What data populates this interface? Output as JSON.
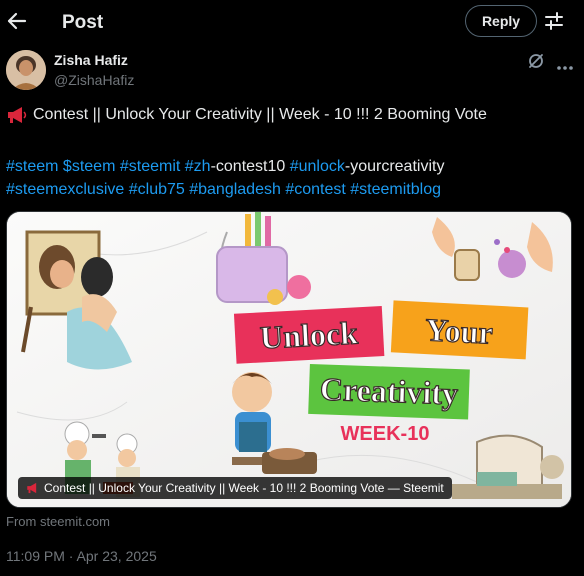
{
  "header": {
    "title": "Post",
    "reply_label": "Reply"
  },
  "author": {
    "name": "Zisha Hafiz",
    "handle": "@ZishaHafiz"
  },
  "post": {
    "title": "Contest || Unlock Your Creativity || Week - 10 !!! 2 Booming Vote",
    "tags_line1": [
      {
        "text": "#steem",
        "type": "tag"
      },
      {
        "text": " ",
        "type": "plain"
      },
      {
        "text": "$steem",
        "type": "tag"
      },
      {
        "text": " ",
        "type": "plain"
      },
      {
        "text": "#steemit",
        "type": "tag"
      },
      {
        "text": " ",
        "type": "plain"
      },
      {
        "text": "#zh",
        "type": "tag"
      },
      {
        "text": "-contest10 ",
        "type": "plain"
      },
      {
        "text": "#unlock",
        "type": "tag"
      },
      {
        "text": "-yourcreativity",
        "type": "plain"
      }
    ],
    "tags_line2": [
      {
        "text": "#steemexclusive",
        "type": "tag"
      },
      {
        "text": " ",
        "type": "plain"
      },
      {
        "text": "#club75",
        "type": "tag"
      },
      {
        "text": " ",
        "type": "plain"
      },
      {
        "text": "#bangladesh",
        "type": "tag"
      },
      {
        "text": " ",
        "type": "plain"
      },
      {
        "text": "#contest",
        "type": "tag"
      },
      {
        "text": " ",
        "type": "plain"
      },
      {
        "text": "#steemitblog",
        "type": "tag"
      }
    ]
  },
  "card": {
    "banner_word1": "Unlock",
    "banner_word2": "Your",
    "banner_word3": "Creativity",
    "banner_week": "WEEK-10",
    "caption": "Contest || Unlock Your Creativity || Week - 10 !!! 2 Booming Vote — Steemit"
  },
  "from_line": "From steemit.com",
  "timestamp": "11:09 PM · Apr 23, 2025",
  "colors": {
    "link": "#1d9bf0",
    "muted": "#71767b",
    "banner_red": "#e8315a",
    "banner_orange": "#f7a21b",
    "banner_green": "#5cc43f"
  }
}
